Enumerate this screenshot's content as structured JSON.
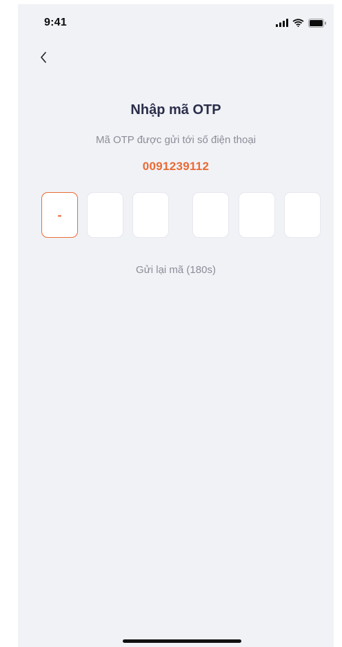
{
  "status_bar": {
    "time": "9:41",
    "icons": [
      "signal-icon",
      "wifi-icon",
      "battery-icon"
    ]
  },
  "header": {
    "back_icon": "chevron-left-icon"
  },
  "main": {
    "title": "Nhập mã OTP",
    "subtitle": "Mã OTP được gửi tới số điện thoại",
    "phone_number": "0091239112",
    "otp": {
      "digits": [
        "-",
        "",
        "",
        "",
        "",
        ""
      ]
    },
    "resend_label": "Gửi lại mã (180s)"
  },
  "colors": {
    "accent": "#ea6a35",
    "title": "#2b2e4a",
    "muted": "#8a8d98",
    "background": "#f1f2f6"
  }
}
